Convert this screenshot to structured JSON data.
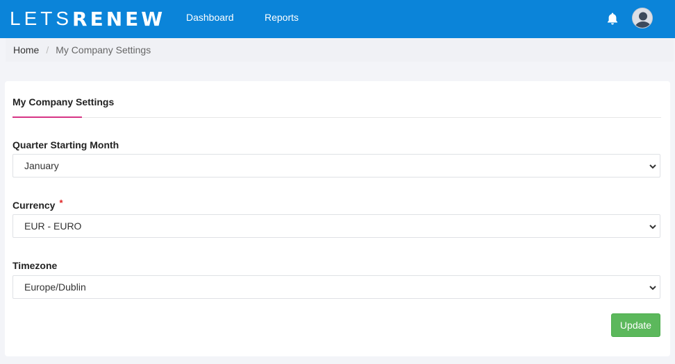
{
  "header": {
    "logo_text_lets": "LETS",
    "logo_text_renew": "RENEW",
    "nav": {
      "dashboard": "Dashboard",
      "reports": "Reports"
    },
    "bell_icon": "bell-icon",
    "avatar_icon": "user-avatar-icon",
    "brand_color": "#0b84d9"
  },
  "breadcrumb": {
    "home": "Home",
    "separator": "/",
    "current": "My Company Settings"
  },
  "card": {
    "title": "My Company Settings",
    "accent_color": "#d63384",
    "fields": {
      "quarter": {
        "label": "Quarter Starting Month",
        "value": "January"
      },
      "currency": {
        "label": "Currency",
        "required_mark": "*",
        "value": "EUR - EURO"
      },
      "timezone": {
        "label": "Timezone",
        "value": "Europe/Dublin"
      }
    },
    "update_label": "Update",
    "update_color": "#5cb85c"
  }
}
